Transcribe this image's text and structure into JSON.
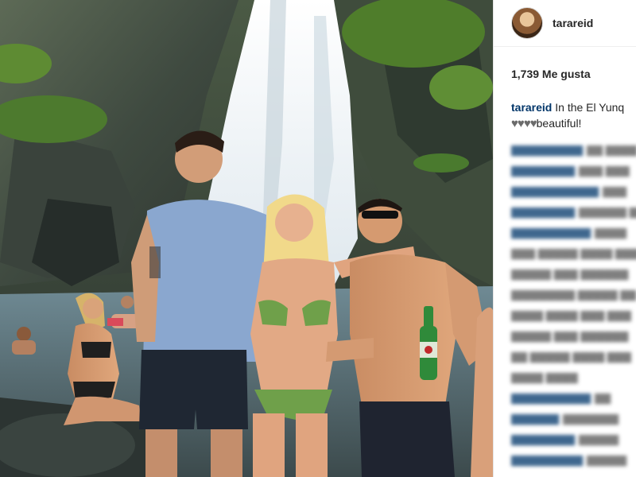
{
  "post": {
    "username": "tarareid",
    "likes": "1,739 Me gusta",
    "caption_user": "tarareid",
    "caption_text_1": "In the El Yunq",
    "caption_hearts": "♥♥♥♥",
    "caption_text_2": "beautiful!"
  },
  "photo": {
    "beer_label": "Heineken"
  },
  "colors": {
    "link_blue": "#003569",
    "text_dark": "#262626",
    "divider": "#efefef"
  },
  "icons": {
    "avatar": "profile-avatar"
  }
}
